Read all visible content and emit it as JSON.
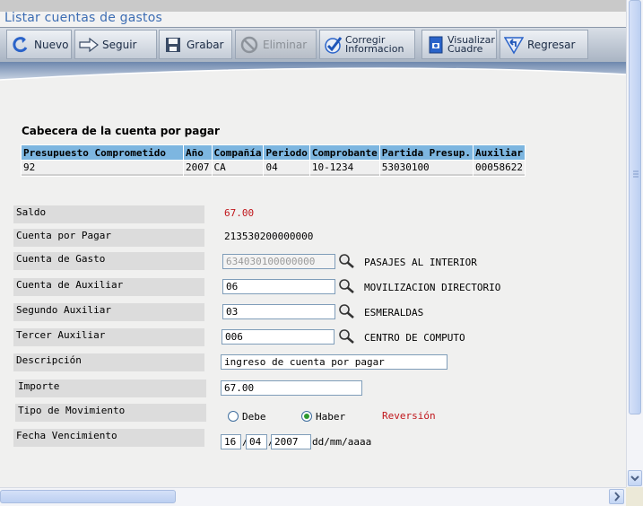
{
  "window": {
    "title": "Listar cuentas de gastos"
  },
  "toolbar": {
    "nuevo": "Nuevo",
    "seguir": "Seguir",
    "grabar": "Grabar",
    "eliminar": "Eliminar",
    "corregir_l1": "Corregir",
    "corregir_l2": "Informacion",
    "visualizar_l1": "Visualizar",
    "visualizar_l2": "Cuadre",
    "regresar": "Regresar"
  },
  "header": {
    "title": "Cabecera de la cuenta por pagar",
    "columns": [
      "Presupuesto Comprometido",
      "Año",
      "Compañía",
      "Periodo",
      "Comprobante",
      "Partida Presup.",
      "Auxiliar"
    ],
    "row": [
      "92",
      "2007",
      "CA",
      "04",
      "10-1234",
      "53030100",
      "00058622"
    ]
  },
  "form": {
    "saldo": {
      "label": "Saldo",
      "value": "67.00"
    },
    "cuenta_pagar": {
      "label": "Cuenta por Pagar",
      "value": "213530200000000"
    },
    "cuenta_gasto": {
      "label": "Cuenta de Gasto",
      "value": "634030100000000",
      "desc": "PASAJES AL INTERIOR"
    },
    "cuenta_auxiliar": {
      "label": "Cuenta de Auxiliar",
      "value": "06",
      "desc": "MOVILIZACION DIRECTORIO"
    },
    "segundo_auxiliar": {
      "label": "Segundo Auxiliar",
      "value": "03",
      "desc": "ESMERALDAS"
    },
    "tercer_auxiliar": {
      "label": "Tercer Auxiliar",
      "value": "006",
      "desc": "CENTRO DE COMPUTO"
    },
    "descripcion": {
      "label": "Descripción",
      "value": "ingreso de cuenta por pagar"
    },
    "importe": {
      "label": "Importe",
      "value": "67.00"
    },
    "tipo_movimiento": {
      "label": "Tipo de Movimiento",
      "debe": "Debe",
      "haber": "Haber",
      "selected": "Haber",
      "reversion": "Reversión"
    },
    "fecha_vencimiento": {
      "label": "Fecha Vencimiento",
      "day": "16",
      "month": "04",
      "year": "2007",
      "sep": "/",
      "format": "dd/mm/aaaa"
    }
  },
  "colors": {
    "accent": "#3d6db3",
    "header_cell": "#7db6e0",
    "negative": "#c0161b"
  }
}
